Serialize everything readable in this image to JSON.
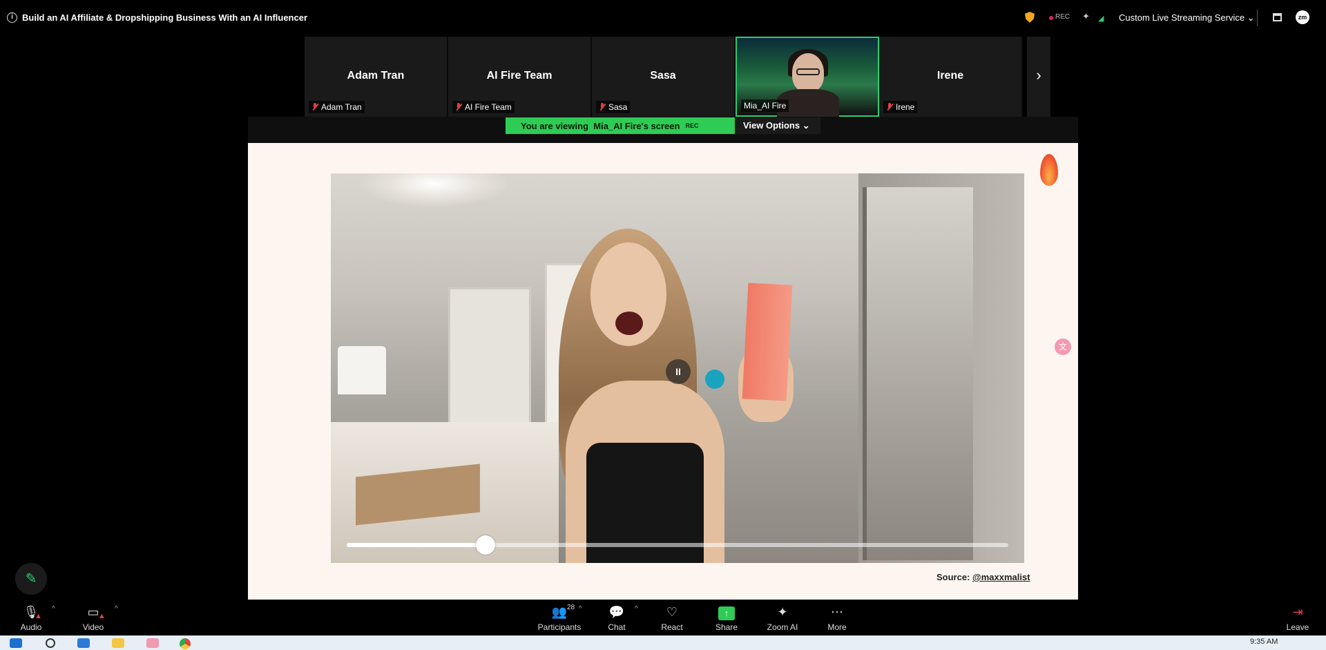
{
  "meeting": {
    "title": "Build an AI Affiliate & Dropshipping Business With an AI Influencer",
    "rec_label": "REC",
    "stream_menu": "Custom Live Streaming Service",
    "avatar_initials": "zm"
  },
  "participants_strip": [
    {
      "big_name": "Adam Tran",
      "label": "Adam Tran",
      "muted": true
    },
    {
      "big_name": "AI Fire Team",
      "label": "AI Fire Team",
      "muted": true
    },
    {
      "big_name": "Sasa",
      "label": "Sasa",
      "muted": true
    },
    {
      "big_name": "",
      "label": "Mia_AI Fire",
      "muted": false,
      "active": true
    },
    {
      "big_name": "Irene",
      "label": "Irene",
      "muted": true
    }
  ],
  "viewing_bar": {
    "prefix": "You are viewing",
    "screen_owner": "Mia_AI Fire's screen",
    "rec": "REC",
    "view_options": "View Options"
  },
  "shared_video": {
    "progress_fraction": 0.21,
    "pause_glyph": "II"
  },
  "source": {
    "label": "Source:",
    "handle": "@maxxmalist"
  },
  "toolbar": {
    "audio": "Audio",
    "video": "Video",
    "participants": "Participants",
    "participants_count": "28",
    "chat": "Chat",
    "react": "React",
    "share": "Share",
    "zoom_ai": "Zoom AI",
    "more": "More",
    "leave": "Leave"
  },
  "taskbar": {
    "clock": "9:35 AM"
  },
  "colors": {
    "accent_green": "#2ecc55",
    "rec_red": "#e0245e",
    "shield": "#f5a623"
  }
}
